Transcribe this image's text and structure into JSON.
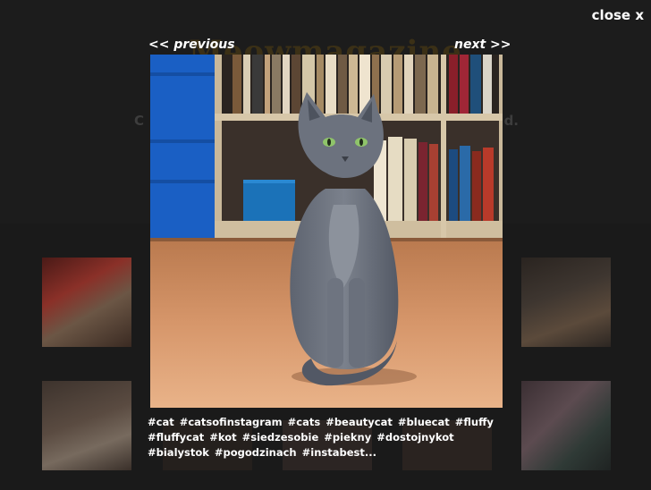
{
  "background": {
    "site_title": "Meowmagazine",
    "subtitle_start": "C",
    "subtitle_end": "d."
  },
  "lightbox": {
    "close_label": "close x",
    "prev_label": "<< previous",
    "next_label": "next >>",
    "caption": "#cat #catsofinstagram #cats #beautycat #bluecat #fluffy #fluffycat #kot #siedzesobie #piekny #dostojnykot #bialystok #pogodzinach #instabest...",
    "photo_alt": "grey cat sitting on wooden floor in front of bookshelf"
  },
  "colors": {
    "backdrop": "#1c1c1c",
    "text": "#ffffff",
    "title_dim": "#3b3016"
  }
}
